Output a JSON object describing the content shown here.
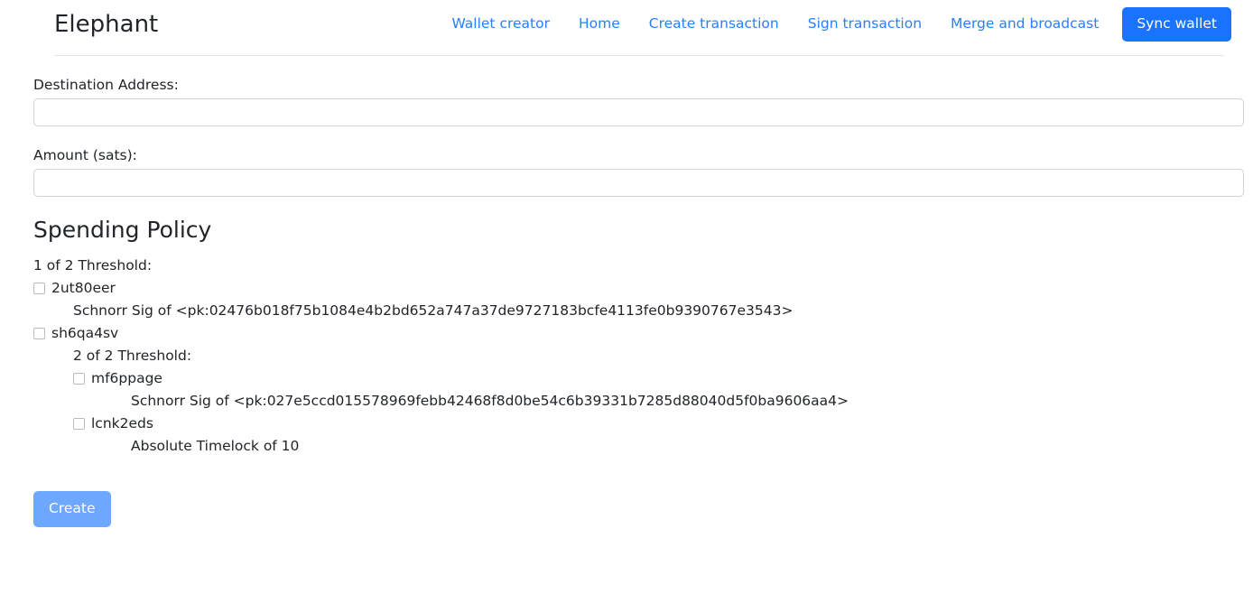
{
  "navbar": {
    "brand": "Elephant",
    "links": [
      {
        "label": "Wallet creator"
      },
      {
        "label": "Home"
      },
      {
        "label": "Create transaction"
      },
      {
        "label": "Sign transaction"
      },
      {
        "label": "Merge and broadcast"
      }
    ],
    "primary_button": "Sync wallet",
    "accent_color": "#1a73ff",
    "link_color": "#2680ff"
  },
  "form": {
    "destination": {
      "label": "Destination Address:",
      "value": "",
      "placeholder": ""
    },
    "amount": {
      "label": "Amount (sats):",
      "value": "",
      "placeholder": ""
    },
    "submit_label": "Create"
  },
  "policy": {
    "title": "Spending Policy",
    "root_threshold": "1 of 2 Threshold:",
    "nodes": [
      {
        "id": "2ut80eer",
        "checked": false,
        "detail": "Schnorr Sig of <pk:02476b018f75b1084e4b2bd652a747a37de9727183bcfe4113fe0b9390767e3543>"
      },
      {
        "id": "sh6qa4sv",
        "checked": false,
        "sub_threshold": "2 of 2 Threshold:",
        "children": [
          {
            "id": "mf6ppage",
            "checked": false,
            "detail": "Schnorr Sig of <pk:027e5ccd015578969febb42468f8d0be54c6b39331b7285d88040d5f0ba9606aa4>"
          },
          {
            "id": "lcnk2eds",
            "checked": false,
            "detail": "Absolute Timelock of 10"
          }
        ]
      }
    ]
  }
}
